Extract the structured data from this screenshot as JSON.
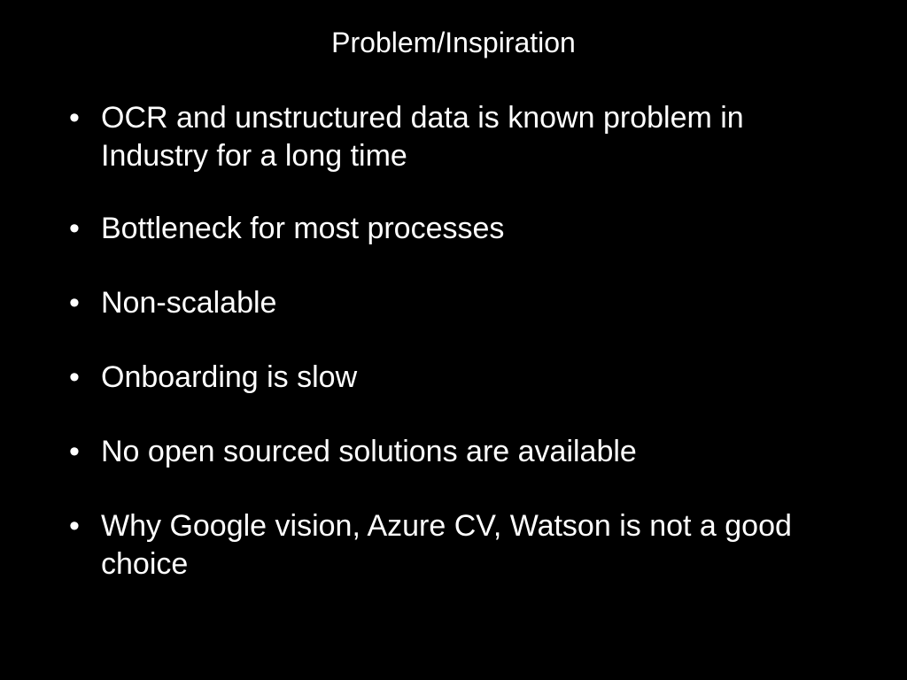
{
  "slide": {
    "title": "Problem/Inspiration",
    "bullet_glyph": "•",
    "bullets": [
      "OCR and unstructured data is known problem in Industry for a long time",
      "Bottleneck for most processes",
      "Non-scalable",
      "Onboarding is slow",
      "No open sourced solutions are available",
      "Why Google vision, Azure CV, Watson is not a good choice"
    ]
  },
  "colors": {
    "background": "#000000",
    "text": "#ffffff"
  }
}
